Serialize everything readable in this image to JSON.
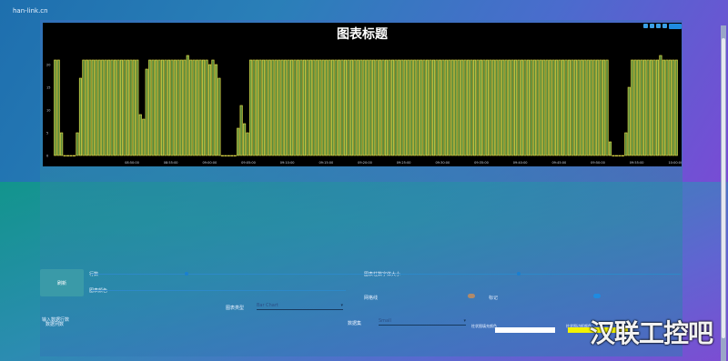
{
  "brand": "han-link.cn",
  "chart": {
    "title": "图表标题",
    "y_ticks": [
      "20",
      "15",
      "10",
      "5",
      "0"
    ],
    "x_ticks": [
      "08:50:00",
      "08:55:00",
      "09:00:00",
      "09:05:00",
      "09:10:00",
      "09:15:00",
      "09:20:00",
      "09:25:00",
      "09:30:00",
      "09:35:00",
      "09:40:00",
      "09:45:00",
      "09:50:00",
      "09:55:00",
      "10:00:00",
      "10:05:00"
    ],
    "bar_fill": "#5c8a3a",
    "bar_stroke": "#f0e84a"
  },
  "chart_data": {
    "type": "bar",
    "title": "图表标题",
    "ylim": [
      0,
      22
    ],
    "values": [
      21,
      21,
      5,
      0,
      0,
      0,
      0,
      5,
      17,
      21,
      21,
      21,
      21,
      21,
      21,
      21,
      21,
      21,
      21,
      21,
      21,
      21,
      21,
      21,
      21,
      21,
      21,
      9,
      8,
      19,
      21,
      21,
      21,
      21,
      21,
      21,
      21,
      21,
      21,
      21,
      21,
      21,
      22,
      21,
      21,
      21,
      21,
      21,
      21,
      20,
      21,
      20,
      17,
      0,
      0,
      0,
      0,
      0,
      6,
      11,
      7,
      5,
      21,
      21,
      21,
      21,
      21,
      21,
      21,
      21,
      21,
      21,
      21,
      21,
      21,
      21,
      21,
      21,
      21,
      21,
      21,
      21,
      21,
      21,
      21,
      21,
      21,
      21,
      21,
      21,
      21,
      21,
      21,
      21,
      21,
      21,
      21,
      21,
      21,
      21,
      21,
      21,
      21,
      21,
      21,
      21,
      21,
      21,
      21,
      21,
      21,
      21,
      21,
      21,
      21,
      21,
      21,
      21,
      21,
      21,
      21,
      21,
      21,
      21,
      21,
      21,
      21,
      21,
      21,
      21,
      21,
      21,
      21,
      21,
      21,
      21,
      21,
      21,
      21,
      21,
      21,
      21,
      21,
      21,
      21,
      21,
      21,
      21,
      21,
      21,
      21,
      21,
      21,
      21,
      21,
      21,
      21,
      21,
      21,
      21,
      21,
      21,
      21,
      21,
      21,
      21,
      21,
      21,
      21,
      21,
      21,
      21,
      21,
      21,
      21,
      21,
      3,
      0,
      0,
      0,
      0,
      5,
      15,
      21,
      21,
      21,
      21,
      21,
      21,
      21,
      21,
      21,
      22,
      21,
      21,
      21,
      21,
      21
    ]
  },
  "controls": {
    "apply_label": "刷新",
    "row_label": "行数",
    "bar_size_label": "图表柱数字体大小",
    "chart_color_label": "图表颜色",
    "chart_type_label": "图表类型",
    "chart_type_value": "Bar Chart",
    "gridlines_label": "网格线",
    "label_label": "标记",
    "dataset_label": "数据集",
    "dataset_value": "Small",
    "left_note_1": "输入数据行数",
    "left_note_2": "数据列数",
    "fill_label": "柱状图填充颜色",
    "stroke_label": "柱状图边框颜色"
  },
  "watermark": "汉联工控吧"
}
